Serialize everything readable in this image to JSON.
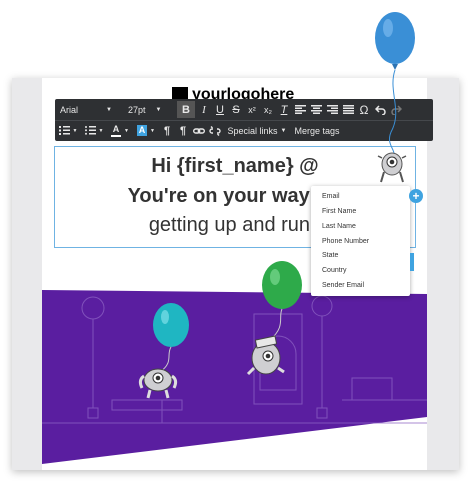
{
  "logo": {
    "text": "yourlogohere"
  },
  "toolbar": {
    "font_family": "Arial",
    "font_size": "27pt",
    "bold": "B",
    "italic": "I",
    "underline": "U",
    "strike": "S",
    "superscript": "x²",
    "subscript": "x₂",
    "clear_format": "T",
    "omega": "Ω",
    "special_links": "Special links",
    "merge_tags": "Merge tags",
    "text_color": "A",
    "bg_color": "A",
    "ltr": "¶",
    "rtl": "¶"
  },
  "editor": {
    "line1": "Hi {first_name} @",
    "line2": "You're on your way! ☺",
    "line3": "getting up and runn"
  },
  "merge_menu": {
    "items": [
      "Email",
      "First Name",
      "Last Name",
      "Phone Number",
      "State",
      "Country",
      "Sender Email"
    ]
  },
  "colors": {
    "toolbar_bg": "#2e3033",
    "purple": "#5a1ea0",
    "accent": "#3fa3e0"
  }
}
